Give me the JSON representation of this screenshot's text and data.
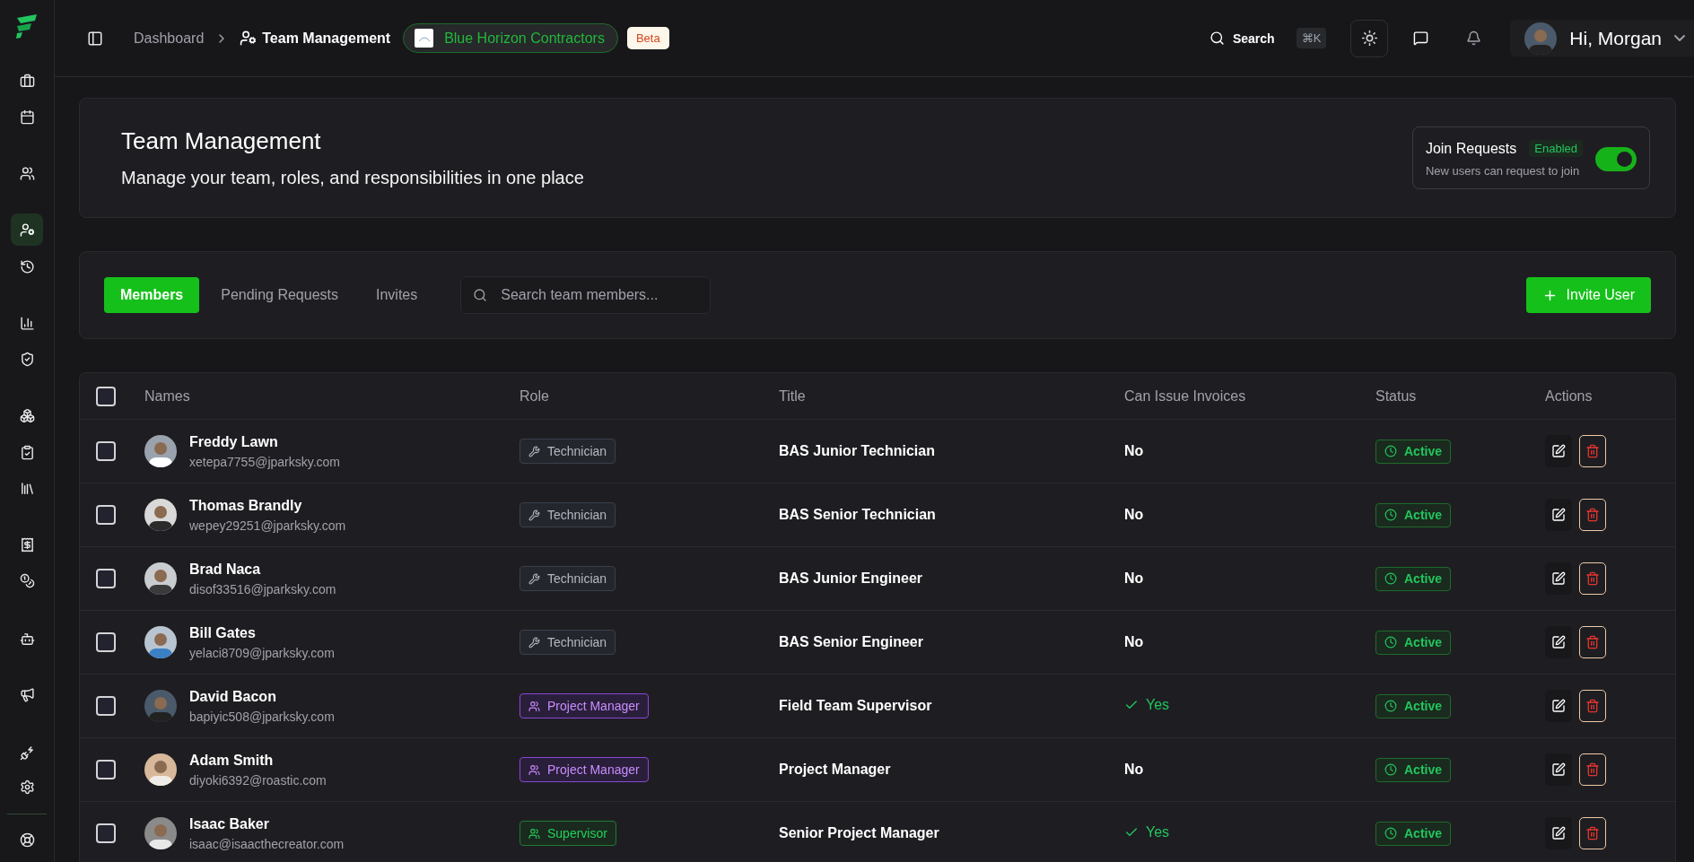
{
  "sidebar": {
    "items": [
      {
        "selected": false
      },
      {
        "selected": false
      },
      {
        "selected": false
      },
      {
        "selected": true
      },
      {
        "selected": false
      },
      {
        "selected": false
      },
      {
        "selected": false
      },
      {
        "selected": false
      },
      {
        "selected": false
      },
      {
        "selected": false
      },
      {
        "selected": false
      },
      {
        "selected": false
      },
      {
        "selected": false
      },
      {
        "selected": false
      },
      {
        "selected": false
      },
      {
        "selected": false
      },
      {
        "selected": false
      }
    ]
  },
  "breadcrumb": {
    "parent": "Dashboard",
    "current": "Team Management"
  },
  "company": {
    "name": "Blue Horizon Contractors"
  },
  "badge": "Beta",
  "search": {
    "label": "Search",
    "shortcut": "⌘K"
  },
  "user": {
    "greeting": "Hi, Morgan"
  },
  "header": {
    "title": "Team Management",
    "subtitle": "Manage your team, roles, and responsibilities in one place"
  },
  "join_requests": {
    "label": "Join Requests",
    "status": "Enabled",
    "hint": "New users can request to join",
    "on": true
  },
  "tabs": [
    {
      "label": "Members",
      "selected": true
    },
    {
      "label": "Pending Requests",
      "selected": false
    },
    {
      "label": "Invites",
      "selected": false
    }
  ],
  "member_search": {
    "placeholder": "Search team members..."
  },
  "invite_button": "Invite User",
  "table": {
    "select_all": {
      "checked": false
    },
    "columns": [
      "Names",
      "Role",
      "Title",
      "Can Issue Invoices",
      "Status",
      "Actions"
    ],
    "rows": [
      {
        "checked": false,
        "name": "Freddy Lawn",
        "email": "xetepa7755@jparksky.com",
        "role": {
          "label": "Technician",
          "kind": "technician"
        },
        "title": "BAS Junior Technician",
        "invoices": {
          "text": "No",
          "checked": false
        },
        "status": "Active"
      },
      {
        "checked": false,
        "name": "Thomas Brandly",
        "email": "wepey29251@jparksky.com",
        "role": {
          "label": "Technician",
          "kind": "technician"
        },
        "title": "BAS Senior Technician",
        "invoices": {
          "text": "No",
          "checked": false
        },
        "status": "Active"
      },
      {
        "checked": false,
        "name": "Brad Naca",
        "email": "disof33516@jparksky.com",
        "role": {
          "label": "Technician",
          "kind": "technician"
        },
        "title": "BAS Junior Engineer",
        "invoices": {
          "text": "No",
          "checked": false
        },
        "status": "Active"
      },
      {
        "checked": false,
        "name": "Bill Gates",
        "email": "yelaci8709@jparksky.com",
        "role": {
          "label": "Technician",
          "kind": "technician"
        },
        "title": "BAS Senior Engineer",
        "invoices": {
          "text": "No",
          "checked": false
        },
        "status": "Active"
      },
      {
        "checked": false,
        "name": "David Bacon",
        "email": "bapiyic508@jparksky.com",
        "role": {
          "label": "Project Manager",
          "kind": "manager"
        },
        "title": "Field Team Supervisor",
        "invoices": {
          "text": "Yes",
          "checked": true
        },
        "status": "Active"
      },
      {
        "checked": false,
        "name": "Adam Smith",
        "email": "diyoki6392@roastic.com",
        "role": {
          "label": "Project Manager",
          "kind": "manager"
        },
        "title": "Project Manager",
        "invoices": {
          "text": "No",
          "checked": false
        },
        "status": "Active"
      },
      {
        "checked": false,
        "name": "Isaac Baker",
        "email": "isaac@isaacthecreator.com",
        "role": {
          "label": "Supervisor",
          "kind": "supervisor"
        },
        "title": "Senior Project Manager",
        "invoices": {
          "text": "Yes",
          "checked": true
        },
        "status": "Active"
      }
    ]
  }
}
